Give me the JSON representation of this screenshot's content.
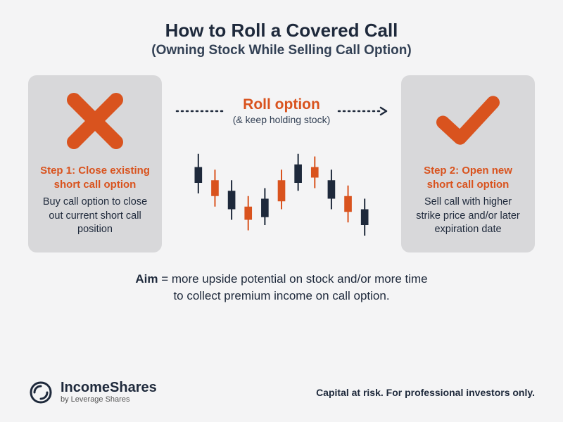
{
  "title": "How to Roll a Covered Call",
  "subtitle": "(Owning Stock While Selling Call Option)",
  "step1": {
    "label": "Step 1: Close existing short call option",
    "body": "Buy call option to close out current short call position"
  },
  "middle": {
    "roll_title": "Roll option",
    "roll_sub": "(& keep holding stock)"
  },
  "step2": {
    "label": "Step 2: Open new short call option",
    "body": "Sell call with higher strike price and/or later expiration date"
  },
  "aim_label": "Aim",
  "aim_text_1": " = more upside potential on stock and/or more time",
  "aim_text_2": "to collect premium income on call option.",
  "logo": {
    "name": "IncomeShares",
    "byline": "by Leverage Shares"
  },
  "disclaimer": "Capital at risk. For professional investors only.",
  "colors": {
    "accent": "#d9531e",
    "dark": "#1e293b",
    "panel": "#d8d8da"
  },
  "chart_data": {
    "type": "candlestick",
    "note": "decorative illustrative price chart, no axes",
    "series": [
      {
        "x": 0,
        "open": 60,
        "close": 48,
        "high": 70,
        "low": 40,
        "color": "dark"
      },
      {
        "x": 1,
        "open": 50,
        "close": 38,
        "high": 58,
        "low": 30,
        "color": "accent"
      },
      {
        "x": 2,
        "open": 42,
        "close": 28,
        "high": 50,
        "low": 20,
        "color": "dark"
      },
      {
        "x": 3,
        "open": 30,
        "close": 20,
        "high": 38,
        "low": 12,
        "color": "accent"
      },
      {
        "x": 4,
        "open": 22,
        "close": 36,
        "high": 44,
        "low": 16,
        "color": "dark"
      },
      {
        "x": 5,
        "open": 34,
        "close": 50,
        "high": 58,
        "low": 28,
        "color": "accent"
      },
      {
        "x": 6,
        "open": 48,
        "close": 62,
        "high": 70,
        "low": 42,
        "color": "dark"
      },
      {
        "x": 7,
        "open": 60,
        "close": 52,
        "high": 68,
        "low": 44,
        "color": "accent"
      },
      {
        "x": 8,
        "open": 50,
        "close": 36,
        "high": 58,
        "low": 28,
        "color": "dark"
      },
      {
        "x": 9,
        "open": 38,
        "close": 26,
        "high": 46,
        "low": 18,
        "color": "accent"
      },
      {
        "x": 10,
        "open": 28,
        "close": 16,
        "high": 36,
        "low": 8,
        "color": "dark"
      }
    ]
  }
}
